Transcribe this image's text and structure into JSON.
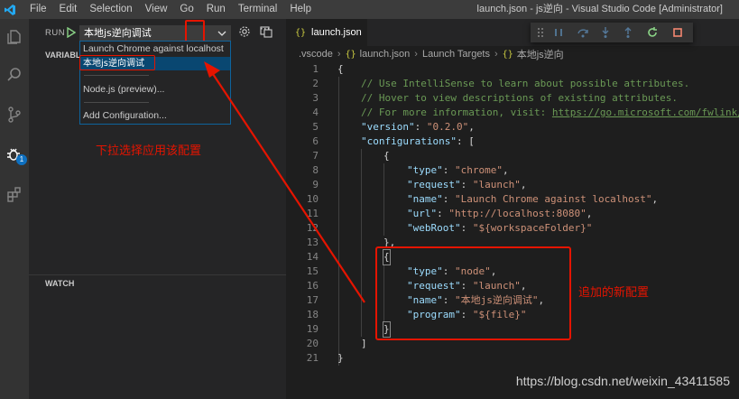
{
  "menu": [
    "File",
    "Edit",
    "Selection",
    "View",
    "Go",
    "Run",
    "Terminal",
    "Help"
  ],
  "window_title": "launch.json - js逆向 - Visual Studio Code [Administrator]",
  "activity": {
    "debug_badge": "1"
  },
  "sidebar": {
    "run_label": "RUN",
    "config_selected": "本地js逆向调试",
    "variables_title": "VARIABLES",
    "watch_title": "WATCH",
    "more": "···"
  },
  "dropdown": {
    "items": [
      "Launch Chrome against localhost",
      "本地js逆向调试",
      "Node.js (preview)...",
      "Add Configuration..."
    ]
  },
  "tab": {
    "label": "launch.json",
    "icon": "{}"
  },
  "breadcrumb": [
    ".vscode",
    "launch.json",
    "Launch Targets",
    "本地js逆向"
  ],
  "code": {
    "line_numbers": [
      "1",
      "2",
      "3",
      "4",
      "5",
      "6",
      "7",
      "8",
      "9",
      "10",
      "11",
      "12",
      "13",
      "14",
      "15",
      "16",
      "17",
      "18",
      "19",
      "20",
      "21"
    ],
    "l1": "{",
    "l2": "// Use IntelliSense to learn about possible attributes.",
    "l3": "// Hover to view descriptions of existing attributes.",
    "l4a": "// For more information, visit: ",
    "l4b": "https://go.microsoft.com/fwlink/?L",
    "l5k": "\"version\"",
    "l5v": "\"0.2.0\"",
    "l6k": "\"configurations\"",
    "l6p": ": [",
    "l7": "{",
    "l8k": "\"type\"",
    "l8v": "\"chrome\"",
    "l9k": "\"request\"",
    "l9v": "\"launch\"",
    "l10k": "\"name\"",
    "l10v": "\"Launch Chrome against localhost\"",
    "l11k": "\"url\"",
    "l11v": "\"http://localhost:8080\"",
    "l12k": "\"webRoot\"",
    "l12v": "\"${workspaceFolder}\"",
    "l13": "},",
    "l14": "{",
    "l15k": "\"type\"",
    "l15v": "\"node\"",
    "l16k": "\"request\"",
    "l16v": "\"launch\"",
    "l17k": "\"name\"",
    "l17v": "\"本地js逆向调试\"",
    "l18k": "\"program\"",
    "l18v": "\"${file}\"",
    "l19": "}",
    "l20": "]",
    "l21": "}"
  },
  "annotations": {
    "dropdown_note": "下拉选择应用该配置",
    "added_note": "追加的新配置",
    "color": "#e51400"
  },
  "watermark": "https://blog.csdn.net/weixin_43411585",
  "colors": {
    "accent": "#0e639c",
    "selection": "#094771",
    "badge": "#0e70c0"
  }
}
